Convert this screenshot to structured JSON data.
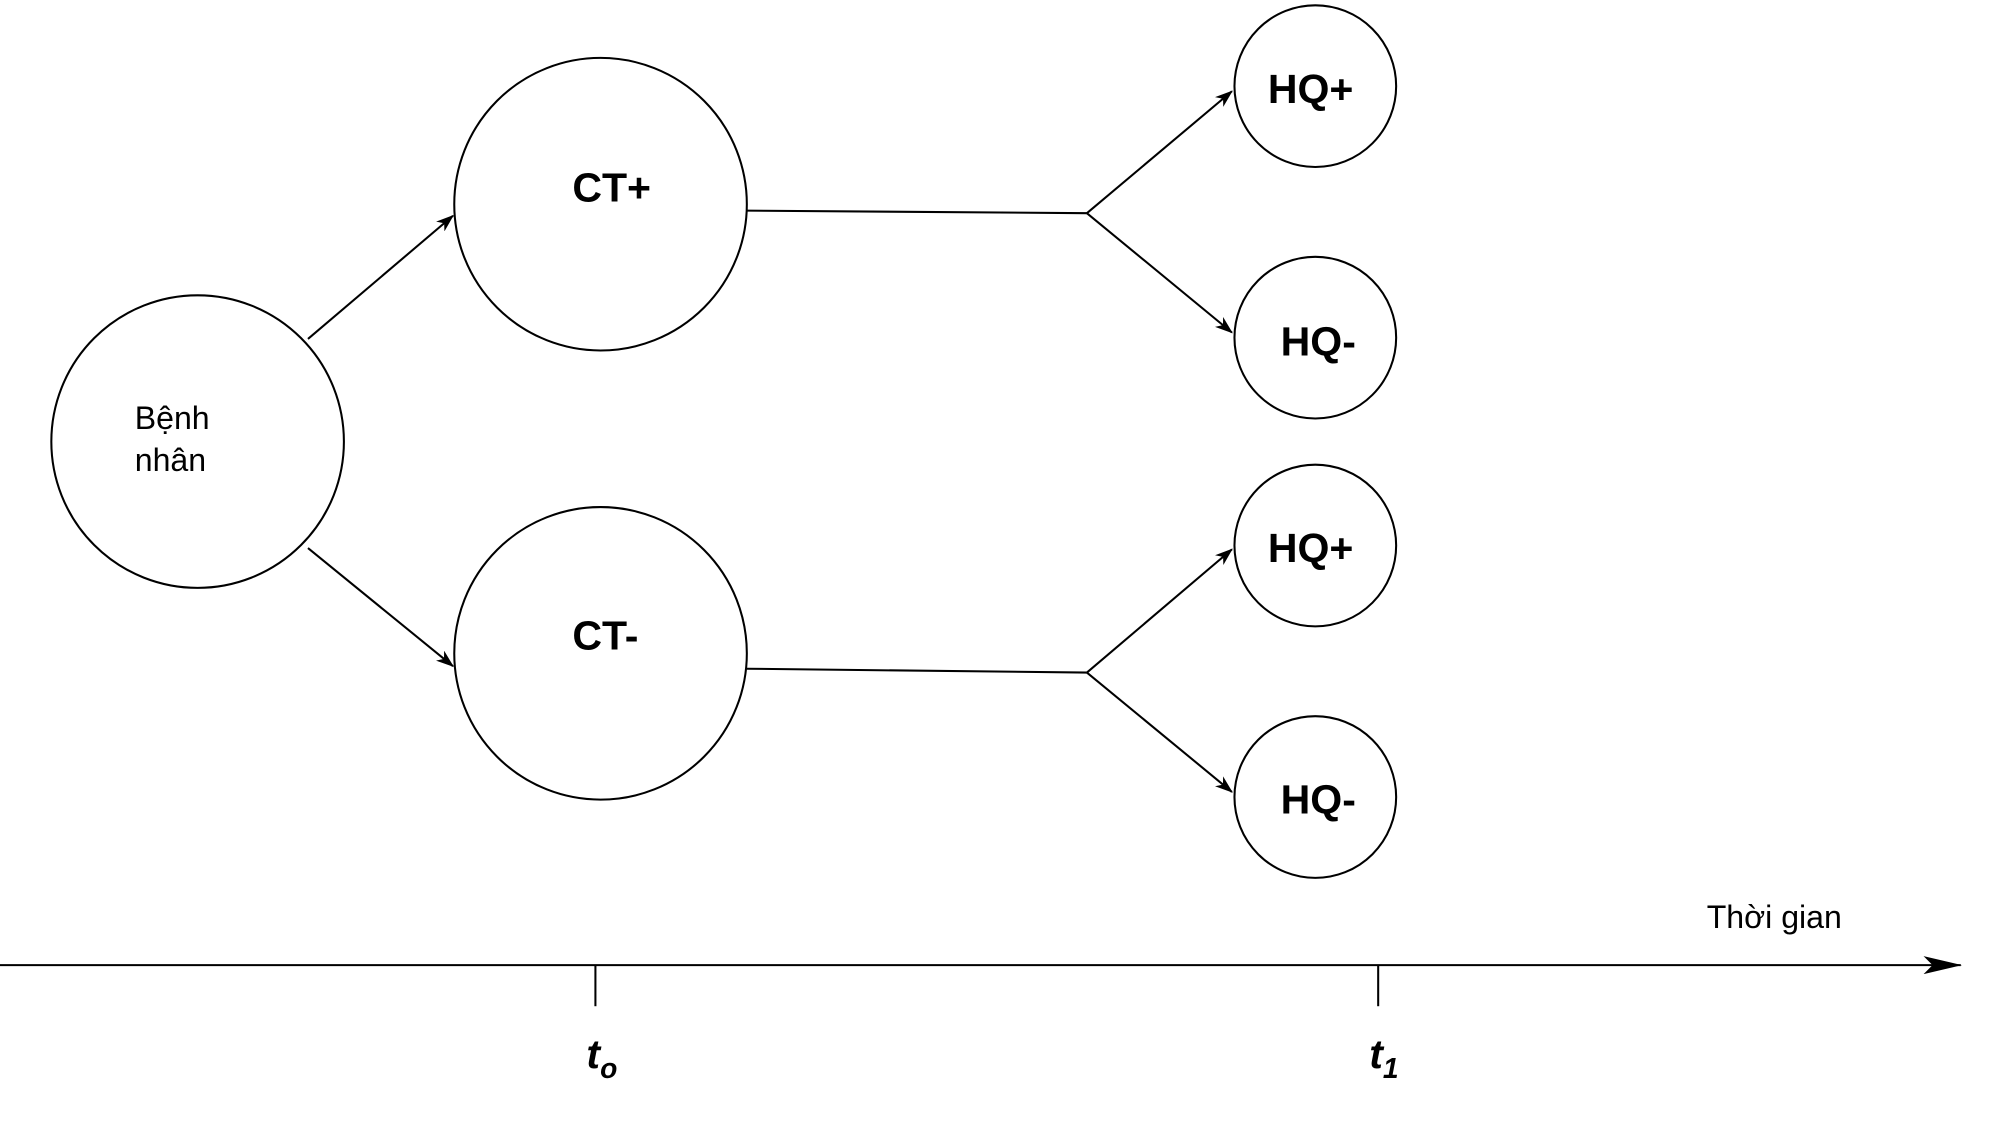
{
  "nodes": {
    "patient": {
      "line1": "Bệnh",
      "line2": "nhân"
    },
    "ct_pos": "CT+",
    "ct_neg": "CT-",
    "hq_pos_1": "HQ+",
    "hq_neg_1": "HQ-",
    "hq_pos_2": "HQ+",
    "hq_neg_2": "HQ-"
  },
  "axis": {
    "label": "Thời gian",
    "ticks": [
      {
        "base": "t",
        "sub": "o"
      },
      {
        "base": "t",
        "sub": "1"
      }
    ]
  }
}
